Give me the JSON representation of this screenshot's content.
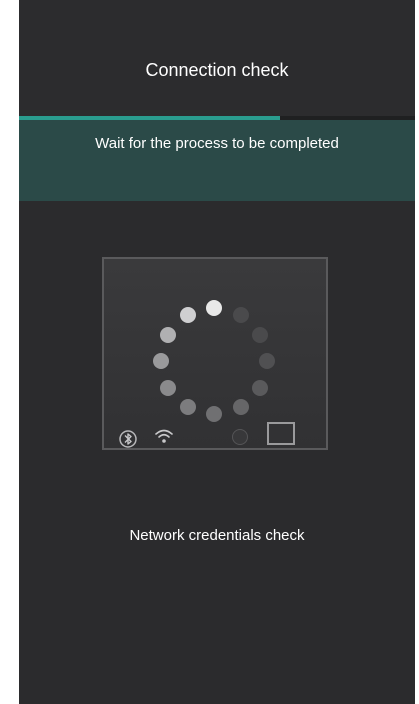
{
  "header": {
    "title": "Connection check"
  },
  "progress": {
    "value": 0.66,
    "color": "#2a9d8f"
  },
  "banner": {
    "message": "Wait for the process to be completed",
    "color": "#2b4a48"
  },
  "device": {
    "icons": [
      "bluetooth-icon",
      "wifi-icon",
      "status-circle-icon",
      "screen-square-icon"
    ]
  },
  "status": {
    "text": "Network credentials check"
  },
  "colors": {
    "background": "#2b2b2d",
    "accent": "#2a9d8f",
    "text": "#ffffff"
  }
}
